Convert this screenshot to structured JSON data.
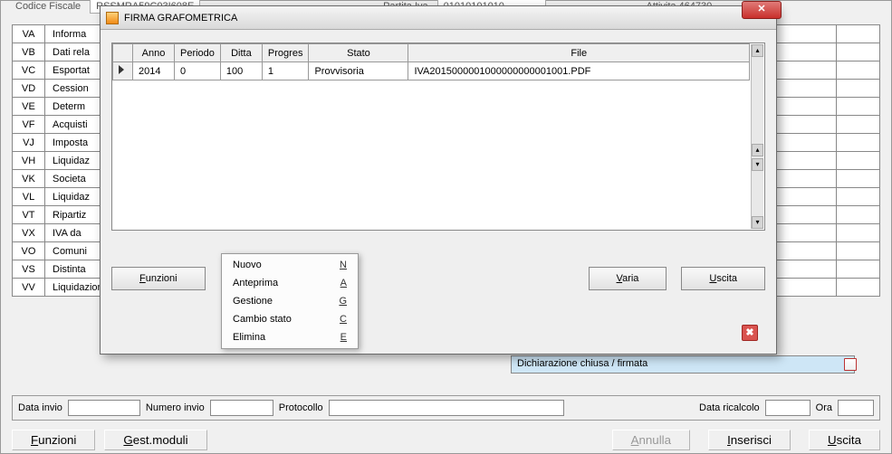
{
  "top": {
    "label_cf": "Codice Fiscale",
    "value_cf": "RSSMRA59C03I608E",
    "label_piva": "Partita Iva",
    "value_piva": "01010101010",
    "label_att": "Attivita 464730"
  },
  "sections": [
    {
      "code": "VA",
      "desc": "Informa"
    },
    {
      "code": "VB",
      "desc": "Dati rela"
    },
    {
      "code": "VC",
      "desc": "Esportat"
    },
    {
      "code": "VD",
      "desc": "Cession"
    },
    {
      "code": "VE",
      "desc": "Determ"
    },
    {
      "code": "VF",
      "desc": "Acquisti"
    },
    {
      "code": "VJ",
      "desc": "Imposta"
    },
    {
      "code": "VH",
      "desc": "Liquidaz"
    },
    {
      "code": "VK",
      "desc": "Societa"
    },
    {
      "code": "VL",
      "desc": "Liquidaz"
    },
    {
      "code": "VT",
      "desc": "Ripartiz"
    },
    {
      "code": "VX",
      "desc": "IVA da"
    },
    {
      "code": "VO",
      "desc": "Comuni"
    },
    {
      "code": "VS",
      "desc": "Distinta"
    },
    {
      "code": "VV",
      "desc": "Liquidazioni periodiche di gruppo"
    }
  ],
  "status_text": "Dichiarazione chiusa / firmata",
  "bottom": {
    "data_invio": "Data invio",
    "numero_invio": "Numero invio",
    "protocollo": "Protocollo",
    "data_ricalcolo": "Data ricalcolo",
    "ora": "Ora"
  },
  "footer": {
    "funzioni": "Funzioni",
    "gest_moduli": "Gest.moduli",
    "annulla": "Annulla",
    "inserisci": "Inserisci",
    "uscita": "Uscita"
  },
  "dialog": {
    "title": "FIRMA GRAFOMETRICA",
    "headers": {
      "sel": "",
      "anno": "Anno",
      "periodo": "Periodo",
      "ditta": "Ditta",
      "progres": "Progres",
      "stato": "Stato",
      "file": "File"
    },
    "row": {
      "anno": "2014",
      "periodo": "0",
      "ditta": "100",
      "progres": "1",
      "stato": "Provvisoria",
      "file": "IVA2015000001000000000001001.PDF"
    },
    "btn_funzioni": "Funzioni",
    "btn_varia": "Varia",
    "btn_uscita": "Uscita"
  },
  "context_menu": [
    {
      "label": "Nuovo",
      "shortcut": "N"
    },
    {
      "label": "Anteprima",
      "shortcut": "A"
    },
    {
      "label": "Gestione",
      "shortcut": "G"
    },
    {
      "label": "Cambio stato",
      "shortcut": "C"
    },
    {
      "label": "Elimina",
      "shortcut": "E"
    }
  ]
}
